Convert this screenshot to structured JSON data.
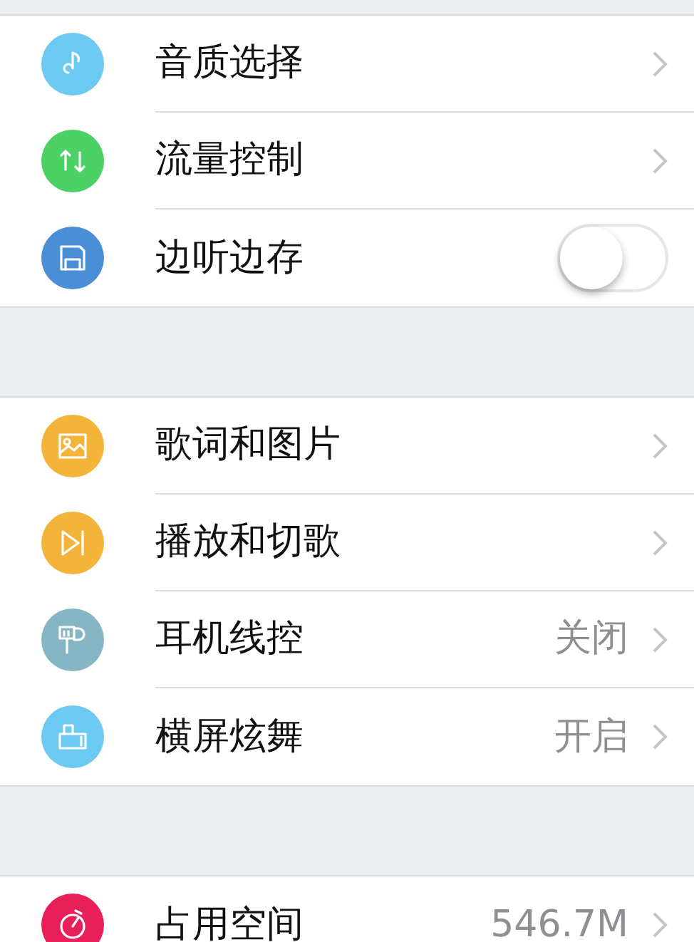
{
  "sections": [
    {
      "items": [
        {
          "kind": "link",
          "label": "音质选择",
          "color": "#6cc9f2"
        },
        {
          "kind": "link",
          "label": "流量控制",
          "color": "#4cd264"
        },
        {
          "kind": "toggle",
          "label": "边听边存",
          "color": "#4a8ed6",
          "on": false
        }
      ]
    },
    {
      "items": [
        {
          "kind": "link",
          "label": "歌词和图片",
          "color": "#f4b43a"
        },
        {
          "kind": "link",
          "label": "播放和切歌",
          "color": "#f4b43a"
        },
        {
          "kind": "link",
          "label": "耳机线控",
          "color": "#86b6c4",
          "value": "关闭"
        },
        {
          "kind": "link",
          "label": "横屏炫舞",
          "color": "#6cc9f2",
          "value": "开启"
        }
      ]
    },
    {
      "items": [
        {
          "kind": "link",
          "label": "占用空间",
          "color": "#e8205a",
          "value": "546.7M"
        }
      ]
    }
  ]
}
